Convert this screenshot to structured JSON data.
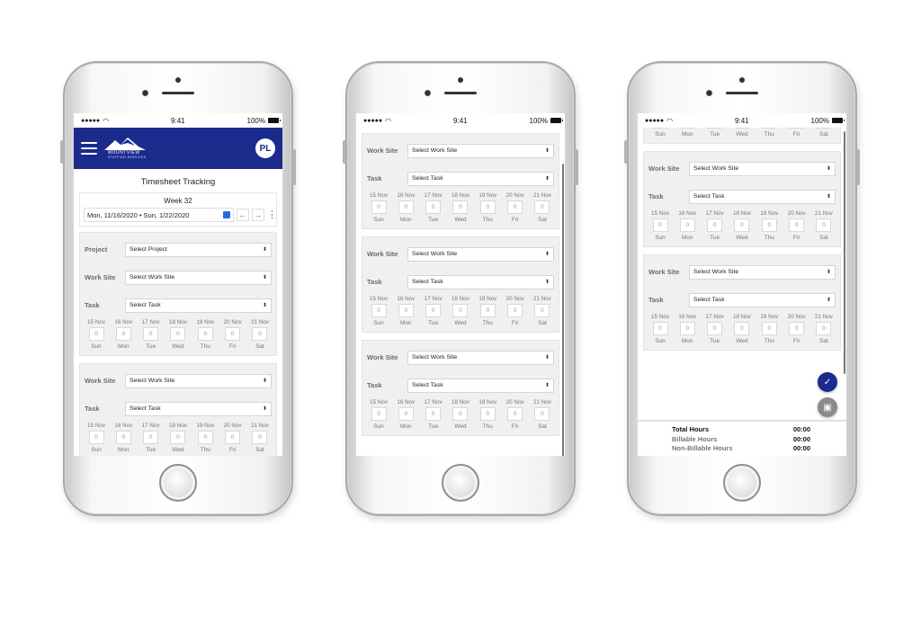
{
  "status": {
    "time": "9:41",
    "battery": "100%",
    "signal_icon": "signal-dots-icon",
    "wifi_icon": "wifi-icon"
  },
  "app": {
    "logo_text": "MOUNTVIEW",
    "logo_sub": "STAFFING SERVICES",
    "avatar_initials": "PL",
    "brand_color": "#1a2b8c",
    "accent_color": "#1e6fd9"
  },
  "page": {
    "title": "Timesheet Tracking",
    "week_label": "Week 32",
    "date_range": "Mon, 11/16/2020 • Sun, 1/22/2020",
    "prev_icon": "←",
    "next_icon": "→"
  },
  "labels": {
    "project": "Project",
    "work_site": "Work Site",
    "task": "Task"
  },
  "placeholders": {
    "project": "Select Project",
    "work_site": "Select Work Site",
    "task": "Select Task"
  },
  "days": [
    {
      "date": "15 Nov",
      "name": "Sun",
      "value": "0"
    },
    {
      "date": "16 Nov",
      "name": "Mon",
      "value": "0"
    },
    {
      "date": "17 Nov",
      "name": "Tue",
      "value": "0"
    },
    {
      "date": "18 Nov",
      "name": "Wed",
      "value": "0"
    },
    {
      "date": "19 Nov",
      "name": "Thu",
      "value": "0"
    },
    {
      "date": "20 Nov",
      "name": "Fri",
      "value": "0"
    },
    {
      "date": "21 Nov",
      "name": "Sat",
      "value": "0"
    }
  ],
  "totals": [
    {
      "label": "Total Hours",
      "value": "00:00"
    },
    {
      "label": "Billable Hours",
      "value": "00:00"
    },
    {
      "label": "Non-Billable Hours",
      "value": "00:00"
    }
  ]
}
